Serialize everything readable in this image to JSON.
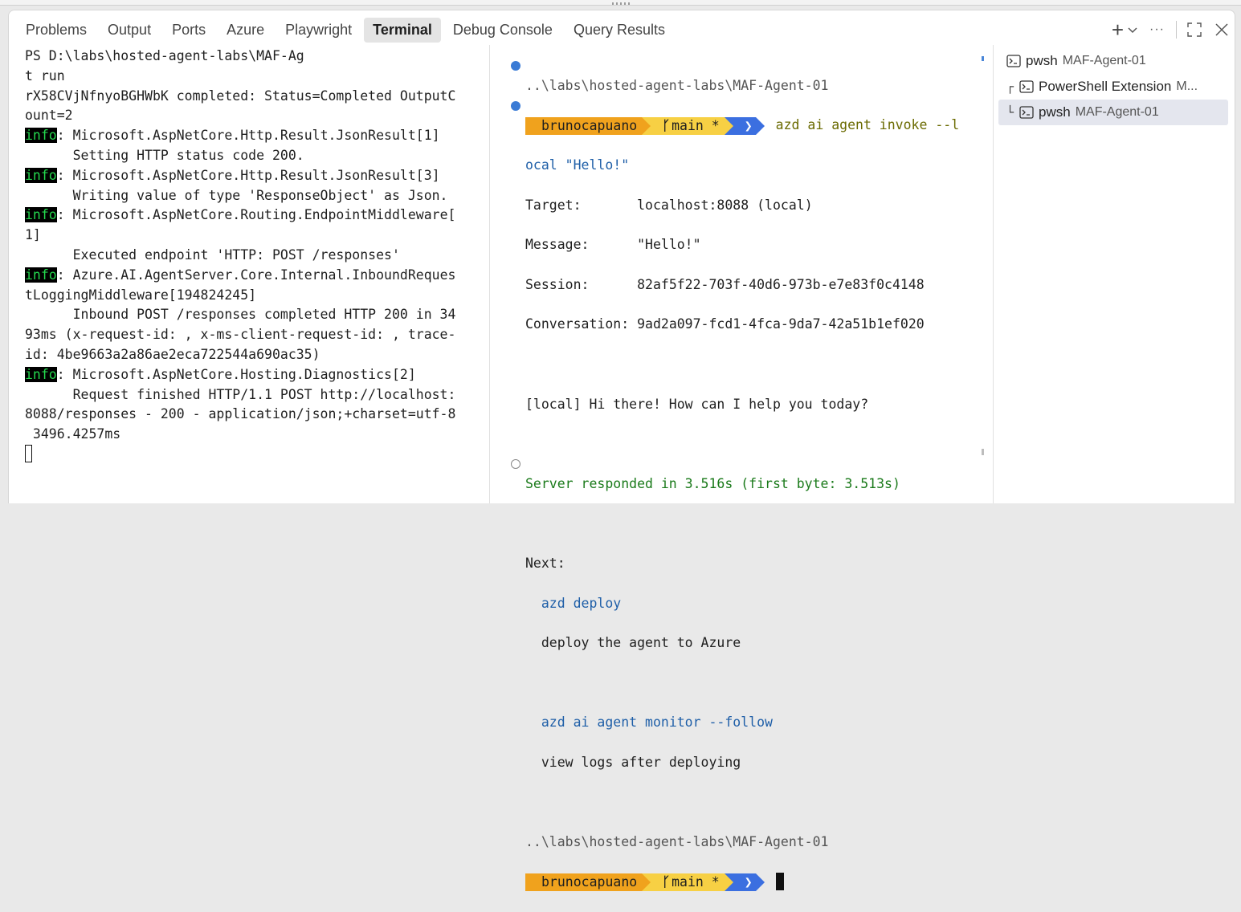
{
  "panel_tabs": [
    "Problems",
    "Output",
    "Ports",
    "Azure",
    "Playwright",
    "Terminal",
    "Debug Console",
    "Query Results"
  ],
  "active_tab": "Terminal",
  "actions": {
    "new_terminal": "+",
    "dropdown": "chevron-down-icon",
    "more": "···",
    "maximize": "maximize-icon",
    "close": "close-icon"
  },
  "terminal_left": {
    "lines": [
      "PS D:\\labs\\hosted-agent-labs\\MAF-Ag",
      "t run",
      "rX58CVjNfnyoBGHWbK completed: Status=Completed OutputC",
      "ount=2",
      "{info}: Microsoft.AspNetCore.Http.Result.JsonResult[1]",
      "      Setting HTTP status code 200.",
      "{info}: Microsoft.AspNetCore.Http.Result.JsonResult[3]",
      "      Writing value of type 'ResponseObject' as Json.",
      "{info}: Microsoft.AspNetCore.Routing.EndpointMiddleware[",
      "1]",
      "      Executed endpoint 'HTTP: POST /responses'",
      "{info}: Azure.AI.AgentServer.Core.Internal.InboundReques",
      "tLoggingMiddleware[194824245]",
      "      Inbound POST /responses completed HTTP 200 in 34",
      "93ms (x-request-id: , x-ms-client-request-id: , trace-",
      "id: 4be9663a2a86ae2eca722544a690ac35)",
      "{info}: Microsoft.AspNetCore.Hosting.Diagnostics[2]",
      "      Request finished HTTP/1.1 POST http://localhost:",
      "8088/responses - 200 - application/json;+charset=utf-8",
      " 3496.4257ms"
    ],
    "info_tag": "info"
  },
  "terminal_right": {
    "path1": "..\\labs\\hosted-agent-labs\\MAF-Agent-01",
    "user": "brunocapuano",
    "branch": "main *",
    "command1": "azd ai agent invoke --l",
    "command1_cont": "ocal \"Hello!\"",
    "target_label": "Target:       ",
    "target_value": "localhost:8088 (local)",
    "message_label": "Message:      ",
    "message_value": "\"Hello!\"",
    "session_label": "Session:      ",
    "session_value": "82af5f22-703f-40d6-973b-e7e83f0c4148",
    "conversation_label": "Conversation: ",
    "conversation_value": "9ad2a097-fcd1-4fca-9da7-42a51b1ef020",
    "reply": "[local] Hi there! How can I help you today?",
    "server_responded": "Server responded in 3.516s (first byte: 3.513s)",
    "next_label": "Next:",
    "next_cmd1": "azd deploy",
    "next_desc1": "deploy the agent to Azure",
    "next_cmd2": "azd ai agent monitor --follow",
    "next_desc2": "view logs after deploying",
    "path2": "..\\labs\\hosted-agent-labs\\MAF-Agent-01"
  },
  "sidebar": {
    "items": [
      {
        "tree": "",
        "name": "pwsh",
        "sub": "MAF-Agent-01"
      },
      {
        "tree": "┌",
        "name": "PowerShell Extension",
        "sub": "M..."
      },
      {
        "tree": "└",
        "name": "pwsh",
        "sub": "MAF-Agent-01"
      }
    ],
    "selected_index": 2
  },
  "colors": {
    "info_bg": "#000000",
    "info_fg": "#24d84e",
    "prompt_user": "#f0a21d",
    "prompt_branch": "#f7d044",
    "prompt_chevron": "#3b6fe0",
    "link": "#1f5fa8",
    "success": "#1a7a1a"
  }
}
